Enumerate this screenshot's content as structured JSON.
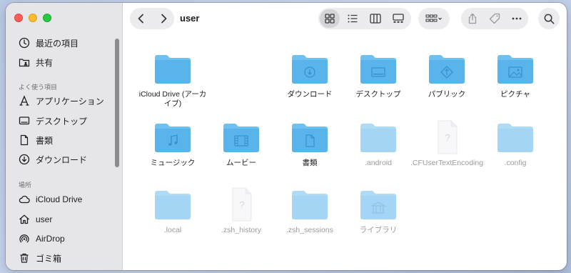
{
  "window": {
    "title": "user"
  },
  "sidebar": {
    "top_items": [
      {
        "label": "最近の項目",
        "icon": "clock-icon"
      },
      {
        "label": "共有",
        "icon": "shared-folder-icon"
      }
    ],
    "favorites_header": "よく使う項目",
    "favorites": [
      {
        "label": "アプリケーション",
        "icon": "applications-icon"
      },
      {
        "label": "デスクトップ",
        "icon": "desktop-icon"
      },
      {
        "label": "書類",
        "icon": "document-icon"
      },
      {
        "label": "ダウンロード",
        "icon": "download-icon"
      }
    ],
    "locations_header": "場所",
    "locations": [
      {
        "label": "iCloud Drive",
        "icon": "cloud-icon"
      },
      {
        "label": "user",
        "icon": "home-icon"
      },
      {
        "label": "AirDrop",
        "icon": "airdrop-icon"
      },
      {
        "label": "ゴミ箱",
        "icon": "trash-icon"
      }
    ]
  },
  "files": [
    {
      "name": "iCloud Drive (アーカイブ)",
      "kind": "folder",
      "glyph": "none",
      "dim": false
    },
    {
      "name": "ダウンロード",
      "kind": "folder",
      "glyph": "download",
      "dim": false
    },
    {
      "name": "デスクトップ",
      "kind": "folder",
      "glyph": "desktop",
      "dim": false
    },
    {
      "name": "パブリック",
      "kind": "folder",
      "glyph": "public",
      "dim": false
    },
    {
      "name": "ピクチャ",
      "kind": "folder",
      "glyph": "picture",
      "dim": false
    },
    {
      "name": "ミュージック",
      "kind": "folder",
      "glyph": "music",
      "dim": false
    },
    {
      "name": "ムービー",
      "kind": "folder",
      "glyph": "movie",
      "dim": false
    },
    {
      "name": "書類",
      "kind": "folder",
      "glyph": "document",
      "dim": false
    },
    {
      "name": ".android",
      "kind": "folder",
      "glyph": "none",
      "dim": true
    },
    {
      "name": ".CFUserTextEncoding",
      "kind": "file",
      "glyph": "question",
      "dim": true
    },
    {
      "name": ".config",
      "kind": "folder",
      "glyph": "none",
      "dim": true
    },
    {
      "name": ".local",
      "kind": "folder",
      "glyph": "none",
      "dim": true
    },
    {
      "name": ".zsh_history",
      "kind": "file",
      "glyph": "question",
      "dim": true
    },
    {
      "name": ".zsh_sessions",
      "kind": "folder",
      "glyph": "none",
      "dim": true
    },
    {
      "name": "ライブラリ",
      "kind": "folder",
      "glyph": "library",
      "dim": true
    }
  ],
  "colors": {
    "folder_top": "#6cc1f0",
    "folder_front": "#5ab4ec",
    "folder_glyph": "#3a8fcf"
  }
}
